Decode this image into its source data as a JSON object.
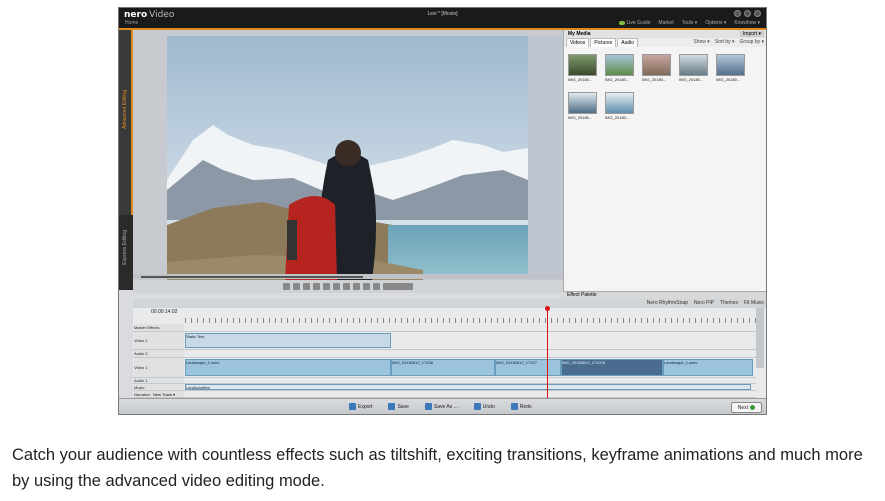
{
  "app": {
    "brand": "nero",
    "product": "Video",
    "home_label": "Home",
    "document_title": "Lexi * [Movie]",
    "menu": [
      "Live Guide",
      "Market",
      "Tools ▾",
      "Options ▾",
      "Knowhow ▾"
    ],
    "accent_color": "#e08a1e"
  },
  "side_tabs": {
    "advanced": "Advanced Editing",
    "express": "Express Editing"
  },
  "media_panel": {
    "title": "My Media",
    "import_label": "Import ▾",
    "tabs": [
      "Videos",
      "Pictures",
      "Audio"
    ],
    "tools": [
      "Show ▾",
      "Sort by ▾",
      "Group by ▾"
    ],
    "thumbnails": [
      {
        "caption": "IMG_20180..."
      },
      {
        "caption": "IMG_20180..."
      },
      {
        "caption": "IMG_20180..."
      },
      {
        "caption": "IMG_20180..."
      },
      {
        "caption": "IMG_20180..."
      },
      {
        "caption": "IMG_20180..."
      },
      {
        "caption": "IMG_20180..."
      }
    ]
  },
  "effect_palette": "Effect Palette",
  "timeline_toolbar": [
    "Nero RhythmSnap",
    "Nero PiP",
    "Themes",
    "Fit Music"
  ],
  "timecode": "00:00:14:02",
  "tracks": [
    {
      "label": "Master Effects"
    },
    {
      "label": "Video 2"
    },
    {
      "label": "Audio 2"
    },
    {
      "label": "Video 1"
    },
    {
      "label": "Audio 1"
    },
    {
      "label": "Music"
    },
    {
      "label": "Narration"
    }
  ],
  "clips": {
    "static_text": "Static Text",
    "landscape1": "Landscape_1.wmv",
    "img1": "IMG_20180812_17208",
    "img2": "IMG_20180812_17207",
    "img3": "IMG_20180812_172078",
    "landscape2": "Landscape_1.wmv",
    "music": "Landschaften"
  },
  "new_track": "New Track ▾",
  "bottom_buttons": [
    "Export",
    "Save",
    "Save As ...",
    "Undo",
    "Redo"
  ],
  "next_label": "Next",
  "caption": "Catch your audience with countless effects such as tiltshift, exciting transitions, keyframe animations and much more by using the advanced video editing mode."
}
